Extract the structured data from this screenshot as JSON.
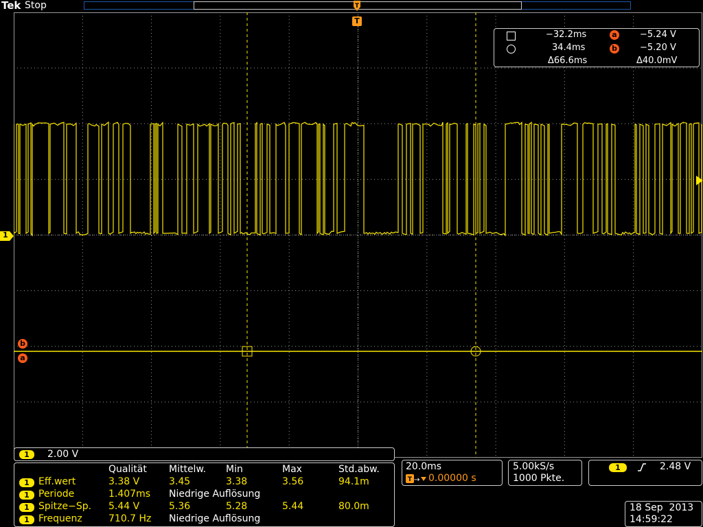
{
  "header": {
    "brand": "Tek",
    "state": "Stop"
  },
  "trigger_marker": {
    "label": "T"
  },
  "channel_marker": {
    "label": "1"
  },
  "ref_markers": {
    "b": "b",
    "a": "a"
  },
  "cursors": {
    "row1": {
      "time": "−32.2ms",
      "badge": "a",
      "volt": "−5.24 V"
    },
    "row2": {
      "time": "34.4ms",
      "badge": "b",
      "volt": "−5.20 V"
    },
    "delta_time": "Δ66.6ms",
    "delta_volt": "Δ40.0mV"
  },
  "scale": {
    "channel": "1",
    "value": "2.00 V"
  },
  "measurements": {
    "headers": [
      "Qualität",
      "Mittelw.",
      "Min",
      "Max",
      "Std.abw."
    ],
    "rows": [
      {
        "ch": "1",
        "name": "Eff.wert",
        "vals": [
          "3.38 V",
          "3.45",
          "3.38",
          "3.56",
          "94.1m"
        ]
      },
      {
        "ch": "1",
        "name": "Periode",
        "vals": [
          "1.407ms",
          "Niedrige Auflösung",
          "",
          "",
          ""
        ]
      },
      {
        "ch": "1",
        "name": "Spitze−Sp.",
        "vals": [
          "5.44 V",
          "5.36",
          "5.28",
          "5.44",
          "80.0m"
        ]
      },
      {
        "ch": "1",
        "name": "Frequenz",
        "vals": [
          "710.7 Hz",
          "Niedrige Auflösung",
          "",
          "",
          ""
        ]
      }
    ]
  },
  "timebase": {
    "scale": "20.0ms",
    "position": "0.00000 s"
  },
  "acquisition": {
    "rate": "5.00kS/s",
    "points": "1000 Pkte."
  },
  "trigger": {
    "channel": "1",
    "level": "2.48 V"
  },
  "datetime": {
    "date": "18 Sep  2013",
    "time": "14:59:22"
  },
  "colors": {
    "trace": "#fbe700",
    "ref": "#ff5a1a",
    "grid": "#9a9a9a",
    "cursor": "#fbe700"
  }
}
